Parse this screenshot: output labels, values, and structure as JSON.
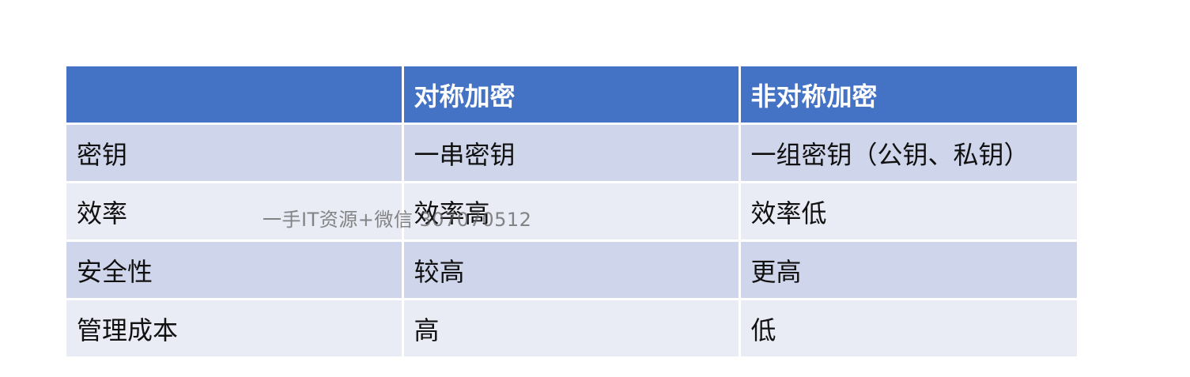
{
  "table": {
    "headers": [
      "",
      "对称加密",
      "非对称加密"
    ],
    "rows": [
      [
        "密钥",
        "一串密钥",
        "一组密钥（公钥、私钥）"
      ],
      [
        "效率",
        "效率高",
        "效率低"
      ],
      [
        "安全性",
        "较高",
        "更高"
      ],
      [
        "管理成本",
        "高",
        "低"
      ]
    ],
    "colors": {
      "header_bg": "#4472c4",
      "row_dark": "#cfd5ea",
      "row_light": "#e9ebf5"
    }
  },
  "watermark": {
    "text": "一手IT资源+微信 307070512"
  }
}
